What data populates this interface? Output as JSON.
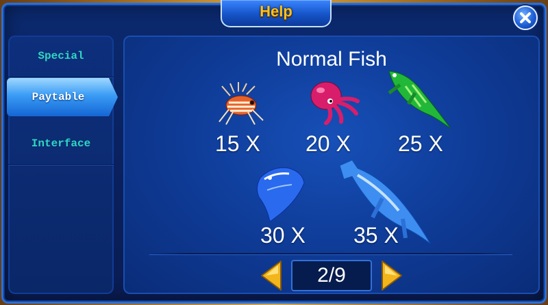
{
  "window": {
    "title": "Help"
  },
  "sidebar": {
    "items": [
      {
        "label": "Special"
      },
      {
        "label": "Paytable",
        "active": true
      },
      {
        "label": "Interface"
      }
    ]
  },
  "content": {
    "section_title": "Normal Fish",
    "fish": [
      {
        "name": "lionfish-icon",
        "multiplier": "15 X"
      },
      {
        "name": "octopus-icon",
        "multiplier": "20 X"
      },
      {
        "name": "green-fish-icon",
        "multiplier": "25 X"
      },
      {
        "name": "manta-ray-icon",
        "multiplier": "30 X"
      },
      {
        "name": "hammerhead-shark-icon",
        "multiplier": "35 X"
      }
    ]
  },
  "pagination": {
    "page": "2/9"
  },
  "colors": {
    "title_gold": "#ffc21a",
    "sidebar_text": "#2fd7c2",
    "panel_blue": "#0f3d9a",
    "arrow_gold": "#f2b51c"
  },
  "icons": {
    "close": "close-icon",
    "prev": "arrow-left-icon",
    "next": "arrow-right-icon"
  }
}
